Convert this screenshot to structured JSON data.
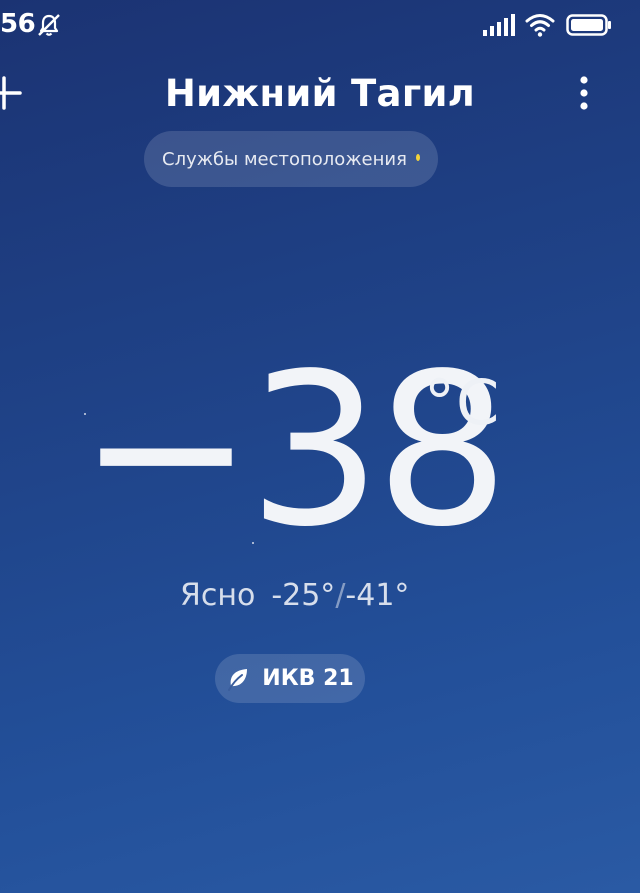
{
  "status_bar": {
    "time": "56",
    "icons": [
      "muted-bell-icon",
      "signal-icon",
      "wifi-icon",
      "battery-icon"
    ]
  },
  "header": {
    "city": "Нижний Тагил",
    "add_icon": "plus-icon",
    "menu_icon": "more-vertical-icon"
  },
  "location_services": {
    "label": "Службы местоположения",
    "dot_color": "#f2d23a"
  },
  "current": {
    "temperature": "−38",
    "unit": "°C",
    "condition": "Ясно",
    "high": "-25°",
    "separator": "/",
    "low": "-41°"
  },
  "air_quality": {
    "label": "ИКВ 21",
    "icon": "leaf-icon"
  },
  "colors": {
    "background_top": "#1b3373",
    "background_bottom": "#2a5aa4"
  }
}
